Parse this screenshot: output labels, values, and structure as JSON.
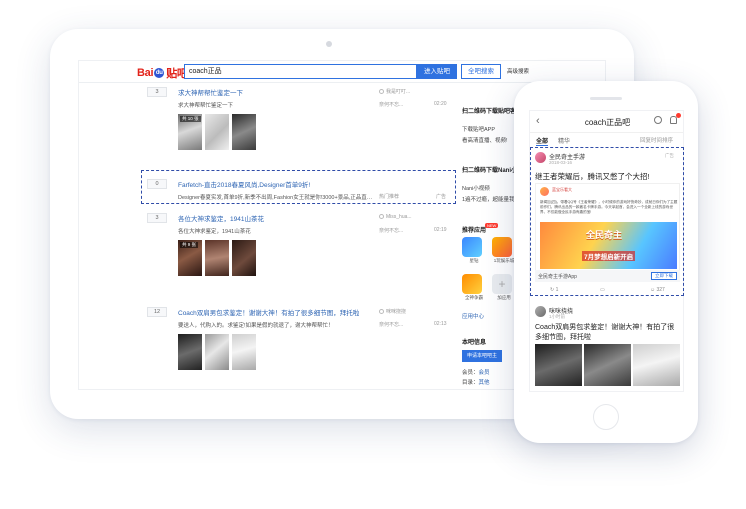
{
  "desktop": {
    "logo_text": "Bai",
    "logo_paw": "du",
    "logo_tieba": "贴吧",
    "search_value": "coach正品",
    "enter_bar_label": "进入贴吧",
    "all_bars_label": "全吧搜索",
    "advanced_search_label": "高级搜索",
    "threads": [
      {
        "count": "3",
        "title": "求大神帮帮忙鉴定一下",
        "author": "我是叮叮...",
        "desc": "求大神帮帮忙鉴定一下",
        "last_reply": "奈何不忘...",
        "time": "02:20",
        "image_count": "共 10 张"
      },
      {
        "count": "0",
        "title": "Farfetch-直击2018春夏风尚,Designer首单9折!",
        "author": "热门推荐",
        "desc": "Designer春夏实发,首单9折,新季不出周,Fashion女王就是你!3000+景品,正品直邮,免费...",
        "ad_label": "广告"
      },
      {
        "count": "3",
        "title": "各位大神求鉴定，1941山茶花",
        "author": "Miss_hua...",
        "desc": "各位大神求鉴定，1941山茶花",
        "last_reply": "奈何不忘...",
        "time": "02:19",
        "image_count": "共 9 张"
      },
      {
        "count": "12",
        "title": "Coach双肩男包求鉴定！谢谢大神！有拍了很多细节图，拜托啦",
        "author": "咪咪挠挠",
        "desc": "要送人，代购入的。求鉴定!如果是假的就退了，谢大神帮帮忙！",
        "last_reply": "奈何不忘...",
        "time": "02:13"
      }
    ]
  },
  "sidebar": {
    "qr_title_1": "扫二维码下载贴吧客",
    "qr_desc_1a": "下载贴吧APP",
    "qr_desc_1b": "看高清直播、视频!",
    "qr_title_2": "扫二维码下载Nani小视",
    "qr_desc_2a": "Nani小视频",
    "qr_desc_2b": "1遍不过瘾，超能量我!",
    "apps_title": "推荐应用",
    "new_badge": "NEW",
    "apps": [
      "星钻",
      "1玩娱乐城",
      "萌宝",
      "全神争霸",
      "加应用"
    ],
    "app_center_label": "应用中心",
    "info_title": "本吧信息",
    "apply_label": "申请本吧吧主",
    "member_label": "会员：",
    "member_value": "会员",
    "dir_label": "目录：",
    "dir_value": "其他"
  },
  "phone": {
    "title": "coach正品吧",
    "tabs": [
      "全部",
      "精华"
    ],
    "sort_label": "回复时间排序",
    "ad": {
      "account": "全民奇主手游",
      "date": "2018-03-16",
      "ad_tag": "广告",
      "headline": "继王者荣耀后，腾讯又憋了个大招!",
      "game_account": "蓝宝乐看大",
      "game_text": "新闻加(四)。带着QQ号《王者荣耀》，小时候你的游戏好快奇妙，成就日你们为了主题前作们。腾讯出品的一款著名卡牌手游。今天拿起首，会进入一个全新上线的游戏世界，不仅能做全民手游有趣的宝!",
      "game_logo": "全民奇主",
      "game_slogan": "7月梦想启新开启",
      "app_name": "全民奇主手游App",
      "download_label": "立即下载",
      "likes": "1",
      "comments": "327"
    },
    "post": {
      "author": "咪咪挠挠",
      "meta": "1小时前",
      "text": "Coach双肩男包求鉴定！谢谢大神！有拍了很多细节图，拜托啦"
    }
  }
}
